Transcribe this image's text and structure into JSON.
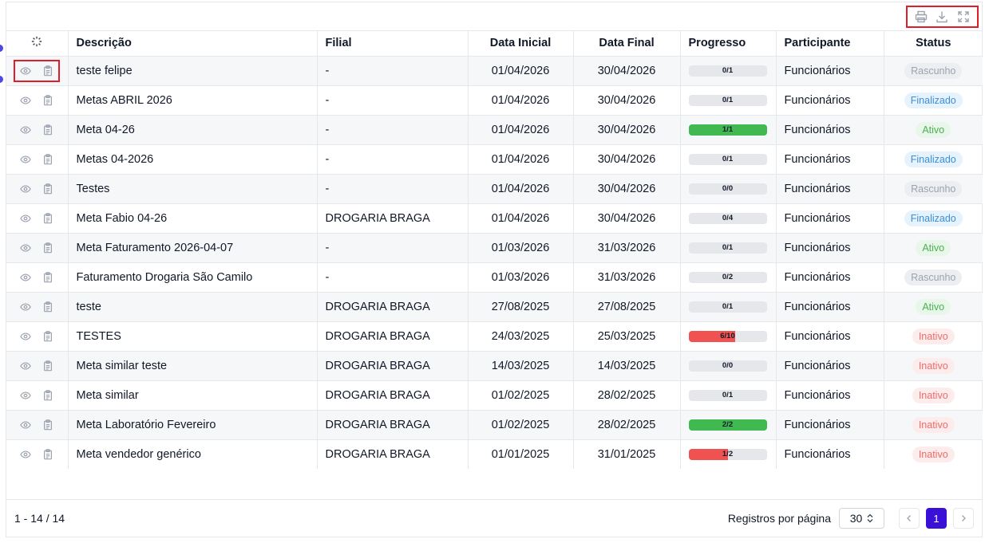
{
  "colors": {
    "accent": "#3b10d6",
    "highlight_border": "#e11d2a",
    "progress_green": "#3fb950",
    "progress_red": "#f05252",
    "progress_track": "#e5e7eb"
  },
  "toolbar": {
    "icons": [
      "print-icon",
      "download-icon",
      "fullscreen-icon"
    ]
  },
  "table": {
    "headers": {
      "actions_icon": "loader-icon",
      "descricao": "Descrição",
      "filial": "Filial",
      "data_inicial": "Data Inicial",
      "data_final": "Data Final",
      "progresso": "Progresso",
      "participante": "Participante",
      "status": "Status"
    },
    "rows": [
      {
        "descricao": "teste felipe",
        "filial": "-",
        "data_inicial": "01/04/2026",
        "data_final": "30/04/2026",
        "progress_label": "0/1",
        "progress": 0.0,
        "progress_color": "none",
        "participante": "Funcionários",
        "status": "Rascunho",
        "status_kind": "rascunho"
      },
      {
        "descricao": "Metas ABRIL 2026",
        "filial": "-",
        "data_inicial": "01/04/2026",
        "data_final": "30/04/2026",
        "progress_label": "0/1",
        "progress": 0.0,
        "progress_color": "none",
        "participante": "Funcionários",
        "status": "Finalizado",
        "status_kind": "finalizado"
      },
      {
        "descricao": "Meta 04-26",
        "filial": "-",
        "data_inicial": "01/04/2026",
        "data_final": "30/04/2026",
        "progress_label": "1/1",
        "progress": 1.0,
        "progress_color": "green",
        "participante": "Funcionários",
        "status": "Ativo",
        "status_kind": "ativo"
      },
      {
        "descricao": "Metas 04-2026",
        "filial": "-",
        "data_inicial": "01/04/2026",
        "data_final": "30/04/2026",
        "progress_label": "0/1",
        "progress": 0.0,
        "progress_color": "none",
        "participante": "Funcionários",
        "status": "Finalizado",
        "status_kind": "finalizado"
      },
      {
        "descricao": "Testes",
        "filial": "-",
        "data_inicial": "01/04/2026",
        "data_final": "30/04/2026",
        "progress_label": "0/0",
        "progress": 0.0,
        "progress_color": "none",
        "participante": "Funcionários",
        "status": "Rascunho",
        "status_kind": "rascunho"
      },
      {
        "descricao": "Meta Fabio 04-26",
        "filial": "DROGARIA BRAGA",
        "data_inicial": "01/04/2026",
        "data_final": "30/04/2026",
        "progress_label": "0/4",
        "progress": 0.0,
        "progress_color": "none",
        "participante": "Funcionários",
        "status": "Finalizado",
        "status_kind": "finalizado"
      },
      {
        "descricao": "Meta Faturamento 2026-04-07",
        "filial": "-",
        "data_inicial": "01/03/2026",
        "data_final": "31/03/2026",
        "progress_label": "0/1",
        "progress": 0.0,
        "progress_color": "none",
        "participante": "Funcionários",
        "status": "Ativo",
        "status_kind": "ativo"
      },
      {
        "descricao": "Faturamento Drogaria São Camilo",
        "filial": "-",
        "data_inicial": "01/03/2026",
        "data_final": "31/03/2026",
        "progress_label": "0/2",
        "progress": 0.0,
        "progress_color": "none",
        "participante": "Funcionários",
        "status": "Rascunho",
        "status_kind": "rascunho"
      },
      {
        "descricao": "teste",
        "filial": "DROGARIA BRAGA",
        "data_inicial": "27/08/2025",
        "data_final": "27/08/2025",
        "progress_label": "0/1",
        "progress": 0.0,
        "progress_color": "none",
        "participante": "Funcionários",
        "status": "Ativo",
        "status_kind": "ativo"
      },
      {
        "descricao": "TESTES",
        "filial": "DROGARIA BRAGA",
        "data_inicial": "24/03/2025",
        "data_final": "25/03/2025",
        "progress_label": "6/10",
        "progress": 0.6,
        "progress_color": "red",
        "participante": "Funcionários",
        "status": "Inativo",
        "status_kind": "inativo"
      },
      {
        "descricao": "Meta similar teste",
        "filial": "DROGARIA BRAGA",
        "data_inicial": "14/03/2025",
        "data_final": "14/03/2025",
        "progress_label": "0/0",
        "progress": 0.0,
        "progress_color": "none",
        "participante": "Funcionários",
        "status": "Inativo",
        "status_kind": "inativo"
      },
      {
        "descricao": "Meta similar",
        "filial": "DROGARIA BRAGA",
        "data_inicial": "01/02/2025",
        "data_final": "28/02/2025",
        "progress_label": "0/1",
        "progress": 0.0,
        "progress_color": "none",
        "participante": "Funcionários",
        "status": "Inativo",
        "status_kind": "inativo"
      },
      {
        "descricao": "Meta Laboratório Fevereiro",
        "filial": "DROGARIA BRAGA",
        "data_inicial": "01/02/2025",
        "data_final": "28/02/2025",
        "progress_label": "2/2",
        "progress": 1.0,
        "progress_color": "green",
        "participante": "Funcionários",
        "status": "Inativo",
        "status_kind": "inativo"
      },
      {
        "descricao": "Meta vendedor genérico",
        "filial": "DROGARIA BRAGA",
        "data_inicial": "01/01/2025",
        "data_final": "31/01/2025",
        "progress_label": "1/2",
        "progress": 0.5,
        "progress_color": "red",
        "participante": "Funcionários",
        "status": "Inativo",
        "status_kind": "inativo"
      }
    ],
    "row_action_icons": [
      "eye-icon",
      "clipboard-icon"
    ]
  },
  "status_styles": {
    "rascunho": {
      "bg": "#eceef1",
      "fg": "#9ca3af"
    },
    "finalizado": {
      "bg": "#e6f2fc",
      "fg": "#3b8fd6"
    },
    "ativo": {
      "bg": "#e8f7ea",
      "fg": "#4caf50"
    },
    "inativo": {
      "bg": "#fdecec",
      "fg": "#ef6b6b"
    }
  },
  "footer": {
    "range": "1 - 14 / 14",
    "per_page_label": "Registros por página",
    "per_page_value": "30",
    "current_page": "1"
  }
}
